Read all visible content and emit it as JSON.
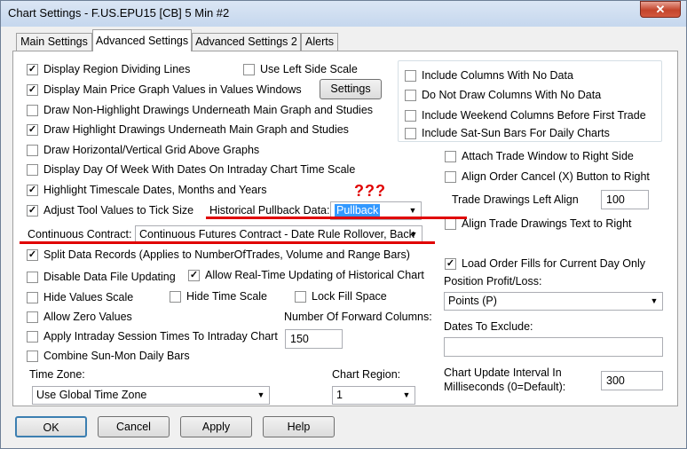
{
  "window": {
    "title": "Chart Settings - F.US.EPU15  [CB]  5 Min   #2",
    "close_glyph": "✕"
  },
  "tabs": [
    "Main Settings",
    "Advanced Settings",
    "Advanced Settings 2",
    "Alerts"
  ],
  "left_checks": [
    {
      "label": "Display Region Dividing Lines",
      "checked": true
    },
    {
      "label": "Display Main Price Graph Values in Values Windows",
      "checked": true
    },
    {
      "label": "Draw Non-Highlight Drawings Underneath Main Graph and Studies",
      "checked": false
    },
    {
      "label": "Draw Highlight Drawings Underneath Main Graph and Studies",
      "checked": true
    },
    {
      "label": "Draw Horizontal/Vertical Grid Above Graphs",
      "checked": false
    },
    {
      "label": "Display Day Of Week With Dates On Intraday Chart Time Scale",
      "checked": false
    },
    {
      "label": "Highlight Timescale Dates, Months and Years",
      "checked": true
    },
    {
      "label": "Adjust Tool Values to Tick Size",
      "checked": true
    }
  ],
  "use_left_side_scale": {
    "label": "Use Left Side Scale",
    "checked": false
  },
  "settings_button": "Settings",
  "historical_pullback": {
    "label": "Historical Pullback Data:",
    "value": "Pullback"
  },
  "annotation": "???",
  "continuous_contract": {
    "label": "Continuous Contract:",
    "value": "Continuous Futures Contract - Date Rule Rollover, Back"
  },
  "lower_checks": {
    "split_data": {
      "label": "Split Data Records (Applies to NumberOfTrades, Volume and Range Bars)",
      "checked": true
    },
    "disable_file_updating": {
      "label": "Disable Data File Updating",
      "checked": false
    },
    "allow_realtime": {
      "label": "Allow Real-Time Updating of Historical Chart",
      "checked": true
    },
    "hide_values_scale": {
      "label": "Hide Values Scale",
      "checked": false
    },
    "hide_time_scale": {
      "label": "Hide Time Scale",
      "checked": false
    },
    "lock_fill_space": {
      "label": "Lock Fill Space",
      "checked": false
    },
    "allow_zero": {
      "label": "Allow Zero Values",
      "checked": false
    },
    "intraday_session": {
      "label": "Apply Intraday Session Times To Intraday Chart",
      "checked": false
    },
    "combine_sun_mon": {
      "label": "Combine Sun-Mon Daily Bars",
      "checked": false
    }
  },
  "forward_columns": {
    "label": "Number Of Forward Columns:",
    "value": "150"
  },
  "time_zone": {
    "label": "Time Zone:",
    "value": "Use Global Time Zone"
  },
  "chart_region": {
    "label": "Chart Region:",
    "value": "1"
  },
  "columns_group": [
    {
      "label": "Include Columns With No Data",
      "checked": false
    },
    {
      "label": "Do Not Draw Columns With No Data",
      "checked": false
    },
    {
      "label": "Include Weekend Columns Before First Trade",
      "checked": false
    },
    {
      "label": "Include Sat-Sun Bars For Daily Charts",
      "checked": false
    }
  ],
  "trade": {
    "attach_window": {
      "label": "Attach Trade Window to Right Side",
      "checked": false
    },
    "align_cancel": {
      "label": "Align Order Cancel (X) Button to Right",
      "checked": false
    },
    "drawings_left_align": {
      "label": "Trade Drawings Left Align",
      "value": "100"
    },
    "align_drawings_text": {
      "label": "Align Trade Drawings Text to Right",
      "checked": false
    },
    "load_order_fills": {
      "label": "Load Order Fills for Current Day Only",
      "checked": true
    },
    "position_pl": {
      "label": "Position Profit/Loss:",
      "value": "Points (P)"
    },
    "dates_exclude": {
      "label": "Dates To Exclude:",
      "value": ""
    },
    "update_interval": {
      "label1": "Chart Update Interval In",
      "label2": "Milliseconds (0=Default):",
      "value": "300"
    }
  },
  "buttons": {
    "ok": "OK",
    "cancel": "Cancel",
    "apply": "Apply",
    "help": "Help"
  },
  "glyphs": {
    "check": "✓",
    "dropdown": "▼"
  }
}
